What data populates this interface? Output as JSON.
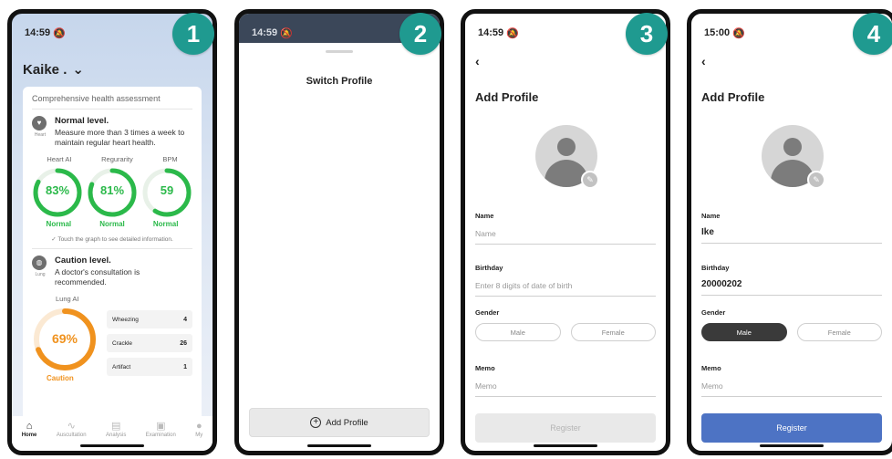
{
  "steps": [
    "1",
    "2",
    "3",
    "4"
  ],
  "screen1": {
    "time": "14:59",
    "battery": "5",
    "profile_name": "Kaike .",
    "card_title": "Comprehensive health assessment",
    "heart": {
      "organ": "Heart",
      "level": "Normal level.",
      "desc": "Measure more than 3 times a week to maintain regular heart health."
    },
    "gauges": [
      {
        "label": "Heart AI",
        "value": "83%",
        "fraction": 0.83,
        "status": "Normal"
      },
      {
        "label": "Regurarity",
        "value": "81%",
        "fraction": 0.81,
        "status": "Normal"
      },
      {
        "label": "BPM",
        "value": "59",
        "fraction": 0.59,
        "status": "Normal"
      }
    ],
    "hint": "✓ Touch the graph to see detailed information.",
    "lung": {
      "organ": "Lung",
      "level": "Caution level.",
      "desc": "A doctor's consultation is recommended.",
      "gauge_label": "Lung AI",
      "value": "69%",
      "fraction": 0.69,
      "status": "Caution"
    },
    "metrics": [
      {
        "name": "Wheezing",
        "value": "4"
      },
      {
        "name": "Crackle",
        "value": "26"
      },
      {
        "name": "Artifact",
        "value": "1"
      }
    ],
    "tabs": [
      "Home",
      "Auscultation",
      "Analysis",
      "Examination",
      "My"
    ]
  },
  "screen2": {
    "time": "14:59",
    "battery": "5",
    "title": "Switch Profile",
    "add_profile": "Add Profile"
  },
  "screen3": {
    "time": "14:59",
    "battery": "5",
    "title": "Add Profile",
    "name_label": "Name",
    "name_value": "Name",
    "birthday_label": "Birthday",
    "birthday_value": "Enter 8 digits of date of birth",
    "gender_label": "Gender",
    "male": "Male",
    "female": "Female",
    "memo_label": "Memo",
    "memo_value": "Memo",
    "register": "Register"
  },
  "screen4": {
    "time": "15:00",
    "battery": "5",
    "title": "Add Profile",
    "name_label": "Name",
    "name_value": "Ike",
    "birthday_label": "Birthday",
    "birthday_value": "20000202",
    "gender_label": "Gender",
    "male": "Male",
    "female": "Female",
    "memo_label": "Memo",
    "memo_value": "Memo",
    "register": "Register"
  },
  "colors": {
    "badge": "#1f9a90",
    "normal": "#2bb94a",
    "caution": "#f0921e",
    "register_active": "#4d73c4"
  },
  "icons": {
    "home": "home-icon",
    "auscultation": "stethoscope-icon",
    "analysis": "chart-icon",
    "examination": "clipboard-icon",
    "my": "person-icon"
  }
}
